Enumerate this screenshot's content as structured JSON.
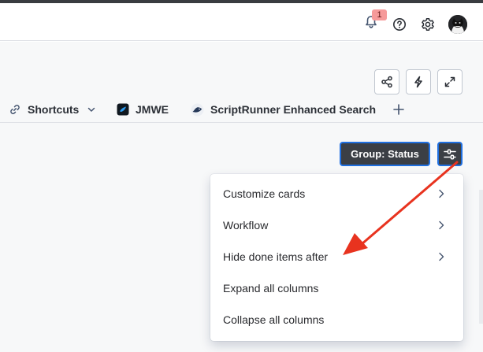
{
  "topbar": {
    "notifications_count": "1",
    "icons": [
      "bell-icon",
      "help-icon",
      "gear-icon",
      "avatar"
    ]
  },
  "toolbar": {
    "icons": [
      "share-icon",
      "lightning-icon",
      "expand-icon"
    ]
  },
  "tabs": [
    {
      "label": "Shortcuts",
      "icon": "link-icon",
      "has_dropdown": true
    },
    {
      "label": "JMWE",
      "icon": "jmwe-app-icon"
    },
    {
      "label": "ScriptRunner Enhanced Search",
      "icon": "scriptrunner-icon"
    }
  ],
  "add_tab_icon": "plus-icon",
  "board_controls": {
    "group_label": "Group: Status",
    "filter_icon": "view-settings-icon"
  },
  "menu": {
    "items": [
      {
        "label": "Customize cards",
        "has_submenu": true
      },
      {
        "label": "Workflow",
        "has_submenu": true
      },
      {
        "label": "Hide done items after",
        "has_submenu": true
      },
      {
        "label": "Expand all columns",
        "has_submenu": false
      },
      {
        "label": "Collapse all columns",
        "has_submenu": false
      }
    ]
  },
  "annotation": {
    "color": "#e8331f"
  },
  "colors": {
    "accent_border": "#1f6fe0",
    "dark_button": "#3b3f45"
  }
}
